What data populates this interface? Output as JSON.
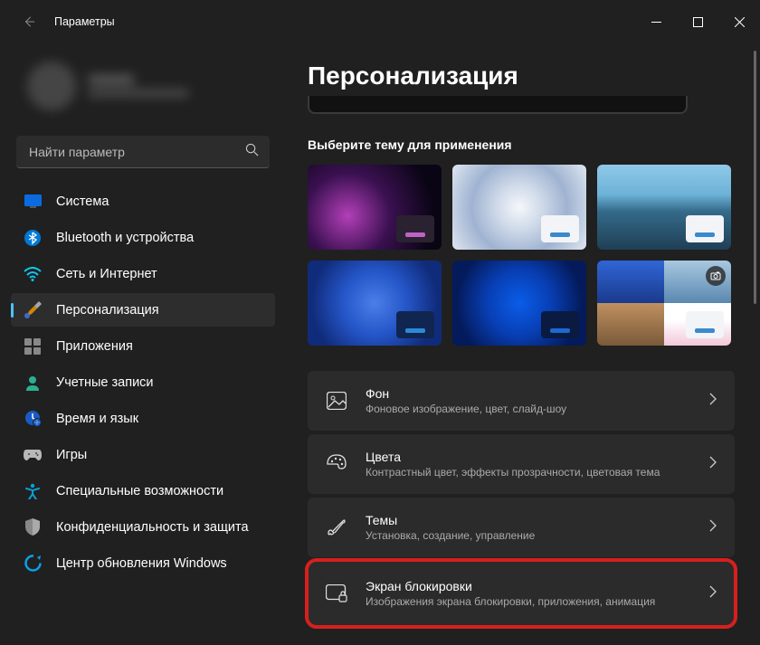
{
  "window": {
    "title": "Параметры"
  },
  "search": {
    "placeholder": "Найти параметр"
  },
  "nav": [
    {
      "label": "Система"
    },
    {
      "label": "Bluetooth и устройства"
    },
    {
      "label": "Сеть и Интернет"
    },
    {
      "label": "Персонализация"
    },
    {
      "label": "Приложения"
    },
    {
      "label": "Учетные записи"
    },
    {
      "label": "Время и язык"
    },
    {
      "label": "Игры"
    },
    {
      "label": "Специальные возможности"
    },
    {
      "label": "Конфиденциальность и защита"
    },
    {
      "label": "Центр обновления Windows"
    }
  ],
  "page": {
    "heading": "Персонализация",
    "theme_section": "Выберите тему для применения"
  },
  "settings": [
    {
      "title": "Фон",
      "sub": "Фоновое изображение, цвет, слайд-шоу"
    },
    {
      "title": "Цвета",
      "sub": "Контрастный цвет, эффекты прозрачности, цветовая тема"
    },
    {
      "title": "Темы",
      "sub": "Установка, создание, управление"
    },
    {
      "title": "Экран блокировки",
      "sub": "Изображения экрана блокировки, приложения, анимация"
    }
  ]
}
